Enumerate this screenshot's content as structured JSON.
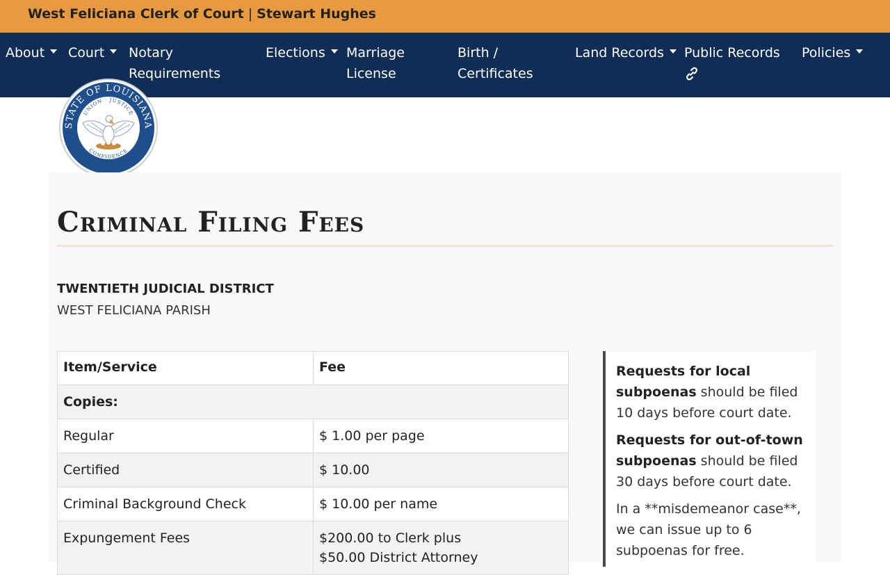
{
  "header": {
    "clerk": "West Feliciana Clerk of Court",
    "separator": "|",
    "name": "Stewart Hughes"
  },
  "nav": {
    "items": [
      {
        "line1": "About",
        "line2": "",
        "dropdown": true
      },
      {
        "line1": "Court",
        "line2": "",
        "dropdown": true
      },
      {
        "line1": "Notary",
        "line2": "Requirements",
        "dropdown": false
      },
      {
        "line1": "Elections",
        "line2": "",
        "dropdown": true
      },
      {
        "line1": "Marriage",
        "line2": "License",
        "dropdown": false
      },
      {
        "line1": "Birth /",
        "line2": "Certificates",
        "dropdown": false
      },
      {
        "line1": "Land Records",
        "line2": "",
        "dropdown": true
      },
      {
        "line1": "Public Records",
        "line2": "",
        "dropdown": false,
        "icon": "link-icon"
      },
      {
        "line1": "Policies",
        "line2": "",
        "dropdown": true
      }
    ]
  },
  "seal": {
    "icon": "louisiana-state-seal",
    "top_text": "STATE OF LOUISIANA",
    "inner_text": "UNION · JUSTICE",
    "bottom_text": "CONFIDENCE"
  },
  "page": {
    "title": "Criminal Filing Fees",
    "district": "TWENTIETH JUDICIAL DISTRICT",
    "parish": "WEST FELICIANA PARISH"
  },
  "table": {
    "headers": [
      "Item/Service",
      "Fee"
    ],
    "section": "Copies:",
    "rows": [
      {
        "item": "Regular",
        "fee": "$ 1.00 per page",
        "fee2": ""
      },
      {
        "item": "Certified",
        "fee": "$ 10.00",
        "fee2": ""
      },
      {
        "item": "Criminal Background Check",
        "fee": "$ 10.00 per name",
        "fee2": ""
      },
      {
        "item": "Expungement Fees",
        "fee": "$200.00 to Clerk plus",
        "fee2": "$50.00 District Attorney"
      }
    ]
  },
  "aside": {
    "p1_bold": "Requests for local subpoenas",
    "p1_rest": " should be filed 10 days before court date.",
    "p2_bold": "Requests for out-of-town subpoenas",
    "p2_rest": " should be filed 30 days before court date.",
    "p3": "In a **misdemeanor case**, we can issue up to 6 subpoenas for free."
  },
  "colors": {
    "topbar": "#e89a40",
    "navbar": "#0f2d55",
    "seal_blue": "#1f4e8c"
  }
}
